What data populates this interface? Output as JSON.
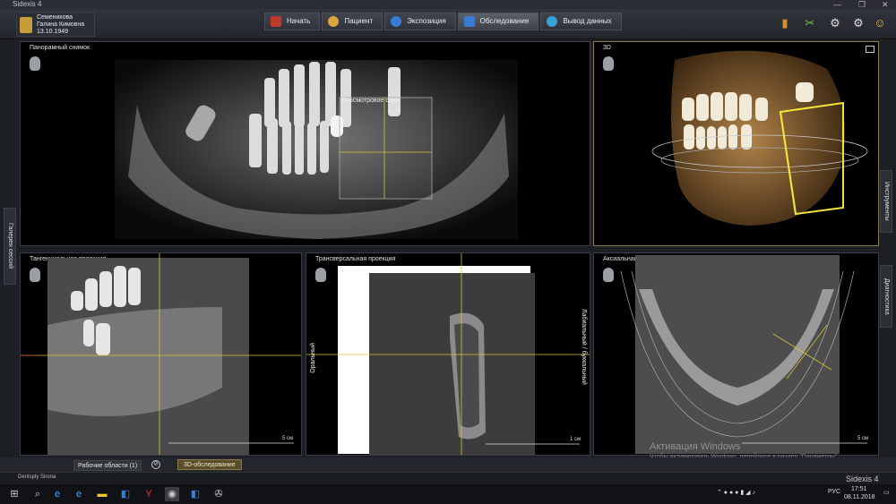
{
  "window": {
    "title": "Sidexis 4",
    "min": "—",
    "max": "❐",
    "close": "✕"
  },
  "patient": {
    "last_name": "Семеникова",
    "first_name": "Галина Кимовна",
    "birth_date": "13.10.1949"
  },
  "workflow": [
    {
      "label": "Начать",
      "icon_color": "#c0392b"
    },
    {
      "label": "Пациент",
      "icon_color": "#d9a441"
    },
    {
      "label": "Экспозиция",
      "icon_color": "#3a7bd5"
    },
    {
      "label": "Обследование",
      "icon_color": "#3a7bd5"
    },
    {
      "label": "Вывод данных",
      "icon_color": "#3aa0d5"
    }
  ],
  "tools": {
    "book": "book-icon",
    "tool": "tools-icon",
    "settings": "gear-icon",
    "help": "help-icon",
    "user": "user-icon"
  },
  "viewers": {
    "panoramic": {
      "title": "Панорамный снимок",
      "window_label": "Просмотровое окно"
    },
    "three_d": {
      "title": "3D"
    },
    "tangential": {
      "title": "Тангенциальная проекция",
      "scale": "5 см"
    },
    "transversal": {
      "title": "Трансверсальная проекция",
      "scale": "1 см",
      "left_label": "Оральный",
      "right_label": "Лабиальный / буккальный"
    },
    "axial": {
      "title": "Аксиальная проекция (сверху)",
      "scale": "5 см"
    }
  },
  "side_tabs": {
    "left": "Галерея сессий",
    "right_top": "Инструменты",
    "right_bottom": "Диагностика"
  },
  "bottom": {
    "workspaces": "Рабочие области (1)",
    "session_tab": "3D-обследование"
  },
  "brand": {
    "vendor": "Dentsply Sirona",
    "product": "Sidexis 4"
  },
  "watermark": {
    "title": "Активация Windows",
    "subtitle": "Чтобы активировать Windows, перейдите в раздел \"Параметры\"."
  },
  "taskbar": {
    "lang": "РУС",
    "time": "17:51",
    "date": "08.11.2018"
  }
}
